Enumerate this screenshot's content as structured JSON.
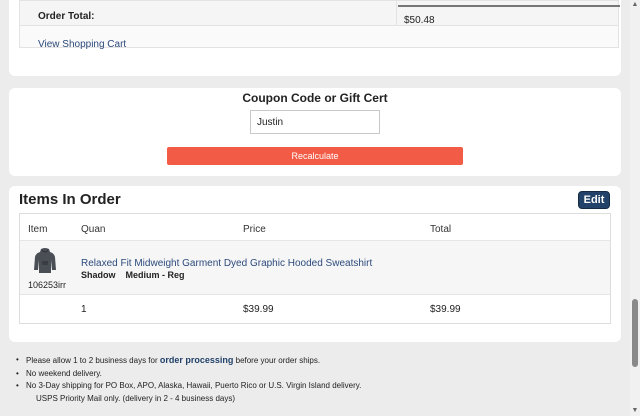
{
  "summary": {
    "order_total_label": "Order Total:",
    "order_total_value": "$50.48",
    "view_cart_link": "View Shopping Cart"
  },
  "coupon": {
    "title": "Coupon Code or Gift Cert",
    "input_value": "Justin",
    "recalculate_label": "Recalculate"
  },
  "items": {
    "title": "Items In Order",
    "edit_label": "Edit",
    "columns": [
      "Item",
      "Quan",
      "Price",
      "Total"
    ],
    "product": {
      "sku": "106253irr",
      "name": "Relaxed Fit Midweight Garment Dyed Graphic Hooded Sweatshirt",
      "color": "Shadow",
      "size": "Medium - Reg",
      "quantity": "1",
      "price": "$39.99",
      "total": "$39.99",
      "thumb_icon": "hoodie-icon"
    }
  },
  "notes": {
    "line1_before": "Please allow 1 to 2 business days for ",
    "line1_strong": "order processing",
    "line1_after": " before your order ships.",
    "line2": "No weekend delivery.",
    "line3": "No 3-Day shipping for PO Box, APO, Alaska, Hawaii, Puerto Rico or U.S. Virgin Island delivery.",
    "line4": "USPS Priority Mail only.  (delivery in 2 - 4 business days)"
  },
  "colors": {
    "accent": "#f25c47",
    "edit_button": "#22426a",
    "link": "#2c4a7c"
  }
}
